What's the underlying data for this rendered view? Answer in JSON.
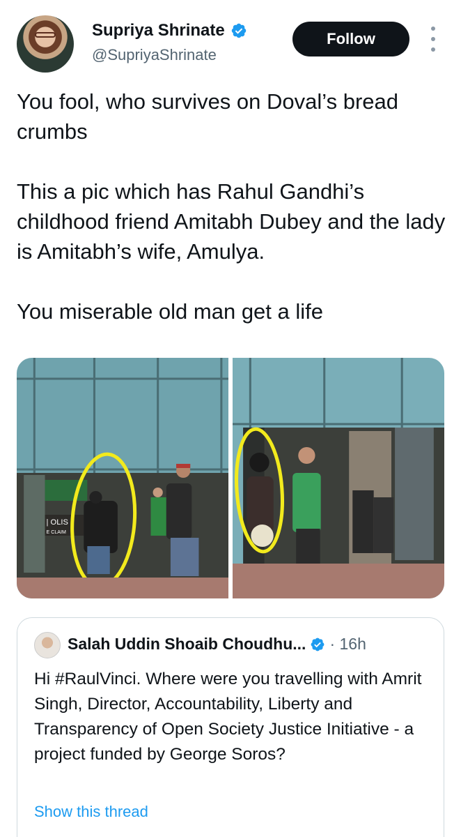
{
  "author": {
    "name": "Supriya Shrinate",
    "handle": "@SupriyaShrinate",
    "verified": true,
    "follow_label": "Follow"
  },
  "tweet": {
    "paragraphs": [
      "You fool, who survives on Doval’s bread crumbs",
      "This a pic which has Rahul Gandhi’s childhood friend Amitabh Dubey and the lady is Amitabh’s wife, Amulya.",
      "You miserable old man get a life"
    ]
  },
  "media": {
    "photos": [
      {
        "sign_text_1": "| OLIS",
        "sign_text_2": "E CLAIM"
      },
      {}
    ]
  },
  "quoted_tweet": {
    "name": "Salah Uddin Shoaib Choudhu...",
    "verified": true,
    "time": "· 16h",
    "text": "Hi #RaulVinci. Where were you travelling with Amrit Singh, Director, Accountability, Liberty and Transparency of Open Society Justice Initiative - a project funded by George Soros?",
    "show_thread_label": "Show this thread"
  },
  "colors": {
    "accent": "#1d9bf0",
    "text": "#0f1419",
    "secondary": "#536471",
    "highlight": "#f2ea1d"
  }
}
